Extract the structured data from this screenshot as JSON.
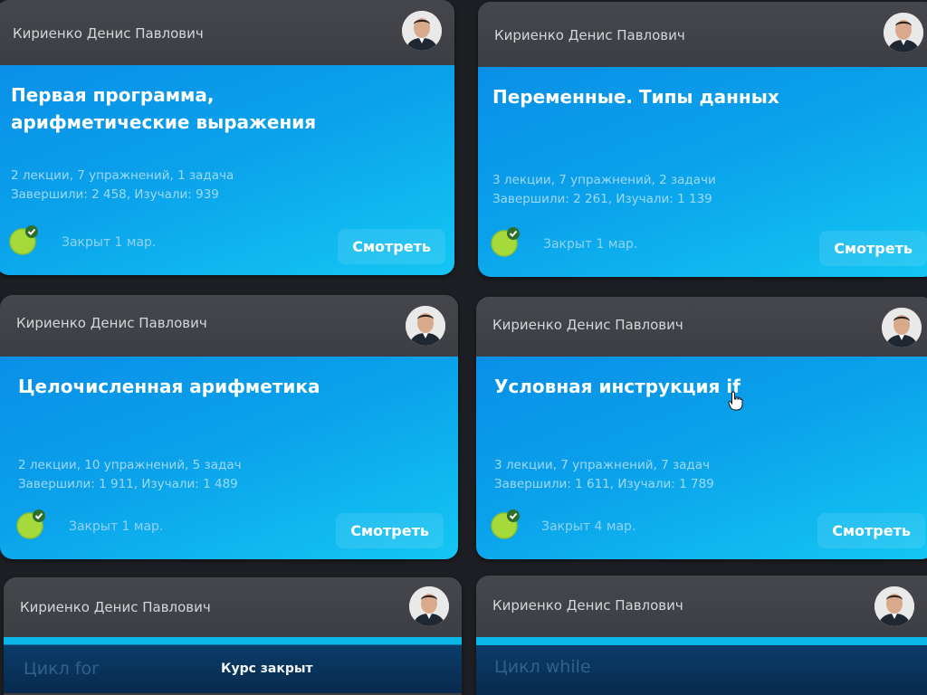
{
  "courses": [
    {
      "author": "Кириенко Денис Павлович",
      "title": "Первая программа,\nарифметические выражения",
      "stats_line1": "2 лекции, 7 упражнений, 1 задача",
      "stats_line2": "Завершили: 2 458, Изучали: 939",
      "closed": "Закрыт 1 мар.",
      "button": "Смотреть"
    },
    {
      "author": "Кириенко Денис Павлович",
      "title": "Переменные. Типы данных",
      "stats_line1": "3 лекции, 7 упражнений, 2 задачи",
      "stats_line2": "Завершили: 2 261, Изучали: 1 139",
      "closed": "Закрыт 1 мар.",
      "button": "Смотреть"
    },
    {
      "author": "Кириенко Денис Павлович",
      "title": "Целочисленная арифметика",
      "stats_line1": "2 лекции, 10 упражнений, 5 задач",
      "stats_line2": "Завершили: 1 911, Изучали: 1 489",
      "closed": "Закрыт 1 мар.",
      "button": "Смотреть"
    },
    {
      "author": "Кириенко Денис Павлович",
      "title": "Условная инструкция if",
      "stats_line1": "3 лекции, 7 упражнений, 7 задач",
      "stats_line2": "Завершили: 1 611, Изучали: 1 789",
      "closed": "Закрыт 4 мар.",
      "button": "Смотреть"
    },
    {
      "author": "Кириенко Денис Павлович",
      "title": "Цикл for",
      "locked": "Курс закрыт"
    },
    {
      "author": "Кириенко Денис Павлович",
      "title": "Цикл while"
    }
  ],
  "colors": {
    "background": "#1d1f24",
    "card_header": "#3c3e44",
    "card_blue_start": "#0a8fe8",
    "card_blue_end": "#14c6f3",
    "check_green": "#a6d93a"
  }
}
